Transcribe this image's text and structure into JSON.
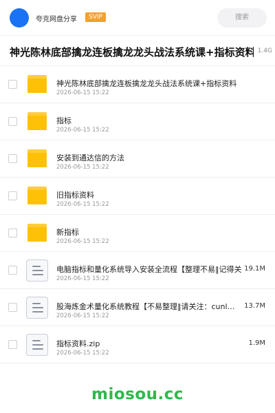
{
  "header": {
    "app_name": "夸克网盘分享",
    "badge": "SVIP",
    "search_placeholder": "搜索",
    "avatar_color": "#1a73f5"
  },
  "share": {
    "title": "神光陈林底部擒龙连板擒龙龙头战法系统课+指标资料",
    "total_size": "1.4G"
  },
  "files": [
    {
      "type": "folder",
      "icon": "folder-icon",
      "name": "神光陈林底部擒龙连板擒龙龙头战法系统课+指标资料",
      "date": "2026-06-15 15:22",
      "size": ""
    },
    {
      "type": "folder",
      "icon": "folder-icon",
      "name": "指标",
      "date": "2026-06-15 15:22",
      "size": ""
    },
    {
      "type": "folder",
      "icon": "folder-icon",
      "name": "安装到通达信的方法",
      "date": "2026-06-15 15:22",
      "size": ""
    },
    {
      "type": "folder",
      "icon": "folder-icon",
      "name": "旧指标资料",
      "date": "2026-06-15 15:22",
      "size": ""
    },
    {
      "type": "folder",
      "icon": "folder-icon",
      "name": "新指标",
      "date": "2026-06-15 15:22",
      "size": ""
    },
    {
      "type": "file",
      "icon": "document-icon",
      "name": "电脑指标和量化系统导入安装全流程【整理不易‖记得关",
      "date": "2026-06-15 15:22",
      "size": "19.1M"
    },
    {
      "type": "file",
      "icon": "document-icon",
      "name": "股海炼金术量化系统教程【不易整理‖请关注：cunl…",
      "date": "2026-06-15 15:22",
      "size": "13.7M"
    },
    {
      "type": "file",
      "icon": "document-icon",
      "name": "指标资料.zip",
      "date": "2026-06-15 15:22",
      "size": "1.9M"
    }
  ],
  "watermark": "miosou.cc",
  "colors": {
    "folder": "#ffc107",
    "svip_badge": "#f5a128",
    "watermark": "#2fb84b"
  }
}
